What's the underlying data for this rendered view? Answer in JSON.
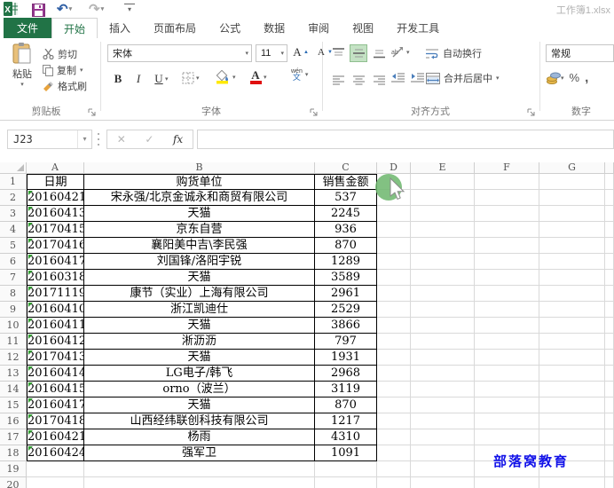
{
  "titlebar": {
    "title": "工作簿1.xlsx"
  },
  "tabs": {
    "file": "文件",
    "home": "开始",
    "insert": "插入",
    "page_layout": "页面布局",
    "formulas": "公式",
    "data": "数据",
    "review": "审阅",
    "view": "视图",
    "developer": "开发工具"
  },
  "ribbon": {
    "clipboard": {
      "group_label": "剪贴板",
      "paste": "粘贴",
      "cut": "剪切",
      "copy": "复制",
      "format_painter": "格式刷"
    },
    "font": {
      "group_label": "字体",
      "font_name": "宋体",
      "font_size": "11",
      "bold": "B",
      "italic": "I",
      "underline": "U",
      "grow": "A",
      "shrink": "A",
      "color_letter": "A",
      "phonetic_top": "wén",
      "phonetic_bottom": "文"
    },
    "alignment": {
      "group_label": "对齐方式",
      "wrap_text": "自动换行",
      "merge_center": "合并后居中",
      "orientation": "ab"
    },
    "number": {
      "group_label": "数字",
      "format": "常规",
      "percent": "%",
      "comma": ","
    }
  },
  "formula_bar": {
    "name_box": "J23",
    "fx": "fx",
    "cancel": "✕",
    "enter": "✓"
  },
  "sheet": {
    "column_headers": [
      "A",
      "B",
      "C",
      "D",
      "E",
      "F",
      "G"
    ],
    "row_headers": [
      "1",
      "2",
      "3",
      "4",
      "5",
      "6",
      "7",
      "8",
      "9",
      "10",
      "11",
      "12",
      "13",
      "14",
      "15",
      "16",
      "17",
      "18",
      "19",
      "20"
    ],
    "table_headers": [
      "日期",
      "购货单位",
      "销售金额"
    ],
    "table_rows": [
      [
        "20160421",
        "宋永强/北京金诚永和商贸有限公司",
        "537"
      ],
      [
        "20160413",
        "天猫",
        "2245"
      ],
      [
        "20170415",
        "京东自营",
        "936"
      ],
      [
        "20170416",
        "襄阳美中吉\\李民强",
        "870"
      ],
      [
        "20160417",
        "刘国锋/洛阳宇锐",
        "1289"
      ],
      [
        "20160318",
        "天猫",
        "3589"
      ],
      [
        "20171119",
        "康节（实业）上海有限公司",
        "2961"
      ],
      [
        "20160410",
        "浙江凯迪仕",
        "2529"
      ],
      [
        "20160411",
        "天猫",
        "3866"
      ],
      [
        "20160412",
        "淅沥沥",
        "797"
      ],
      [
        "20170413",
        "天猫",
        "1931"
      ],
      [
        "20160414",
        "LG电子/韩飞",
        "2968"
      ],
      [
        "20160415",
        "orno（波兰）",
        "3119"
      ],
      [
        "20160417",
        "天猫",
        "870"
      ],
      [
        "20170418",
        "山西经纬联创科技有限公司",
        "1217"
      ],
      [
        "20160421",
        "杨雨",
        "4310"
      ],
      [
        "20160424",
        "强军卫",
        "1091"
      ]
    ]
  },
  "watermark": {
    "text": "部落窝教育"
  },
  "colors": {
    "excel_green": "#217346",
    "highlight_green": "#c4e2c4",
    "error_triangle": "#2e9b2e",
    "watermark_blue": "#1212e8",
    "fill_yellow": "#ffe900",
    "font_red": "#e01010"
  }
}
